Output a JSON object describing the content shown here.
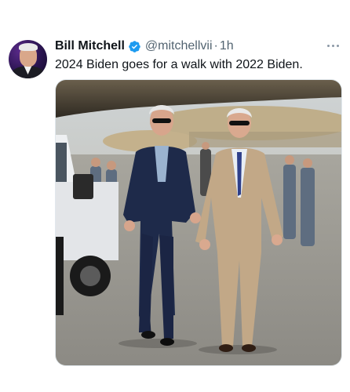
{
  "tweet": {
    "author_name": "Bill Mitchell",
    "handle": "@mitchellvii",
    "separator": "·",
    "time": "1h",
    "text": "2024 Biden goes for a walk with 2022 Biden."
  },
  "colors": {
    "verified": "#1d9bf0",
    "handle_gray": "#536471",
    "text": "#0f1419"
  },
  "icons": {
    "verified": "verified-badge-icon",
    "more": "more-horizontal-icon"
  }
}
